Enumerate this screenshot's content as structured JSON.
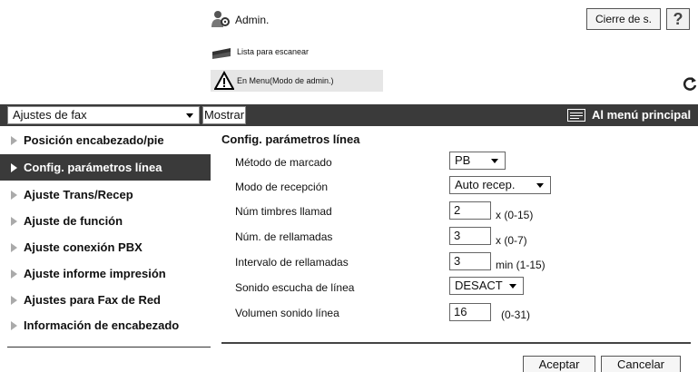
{
  "header": {
    "user_label": "Admin.",
    "logout_label": "Cierre de s.",
    "help_label": "?"
  },
  "status": {
    "scanner_text": "Lista para escanear",
    "mode_text": "En Menu(Modo de admin.)"
  },
  "toolbar": {
    "category_value": "Ajustes de fax",
    "show_label": "Mostrar",
    "main_menu_label": "Al menú principal"
  },
  "sidebar": {
    "items": [
      {
        "label": "Posición encabezado/pie"
      },
      {
        "label": "Config. parámetros línea"
      },
      {
        "label": "Ajuste Trans/Recep"
      },
      {
        "label": "Ajuste de función"
      },
      {
        "label": "Ajuste conexión PBX"
      },
      {
        "label": "Ajuste informe impresión"
      },
      {
        "label": "Ajustes para Fax de Red"
      },
      {
        "label": "Información de encabezado"
      }
    ]
  },
  "main": {
    "title": "Config. parámetros línea",
    "rows": [
      {
        "label": "Método de marcado",
        "value": "PB"
      },
      {
        "label": "Modo de recepción",
        "value": "Auto recep."
      },
      {
        "label": "Núm timbres llamad",
        "value": "2",
        "suffix": "x (0-15)"
      },
      {
        "label": "Núm. de rellamadas",
        "value": "3",
        "suffix": "x (0-7)"
      },
      {
        "label": "Intervalo de rellamadas",
        "value": "3",
        "suffix": "min (1-15)"
      },
      {
        "label": "Sonido escucha de línea",
        "value": "DESACT"
      },
      {
        "label": "Volumen sonido línea",
        "value": "16",
        "suffix": "(0-31)"
      }
    ],
    "ok_label": "Aceptar",
    "cancel_label": "Cancelar"
  },
  "colors": {
    "toolbar_bg": "#3a3a3a",
    "active_item_bg": "#3a3a3a"
  }
}
